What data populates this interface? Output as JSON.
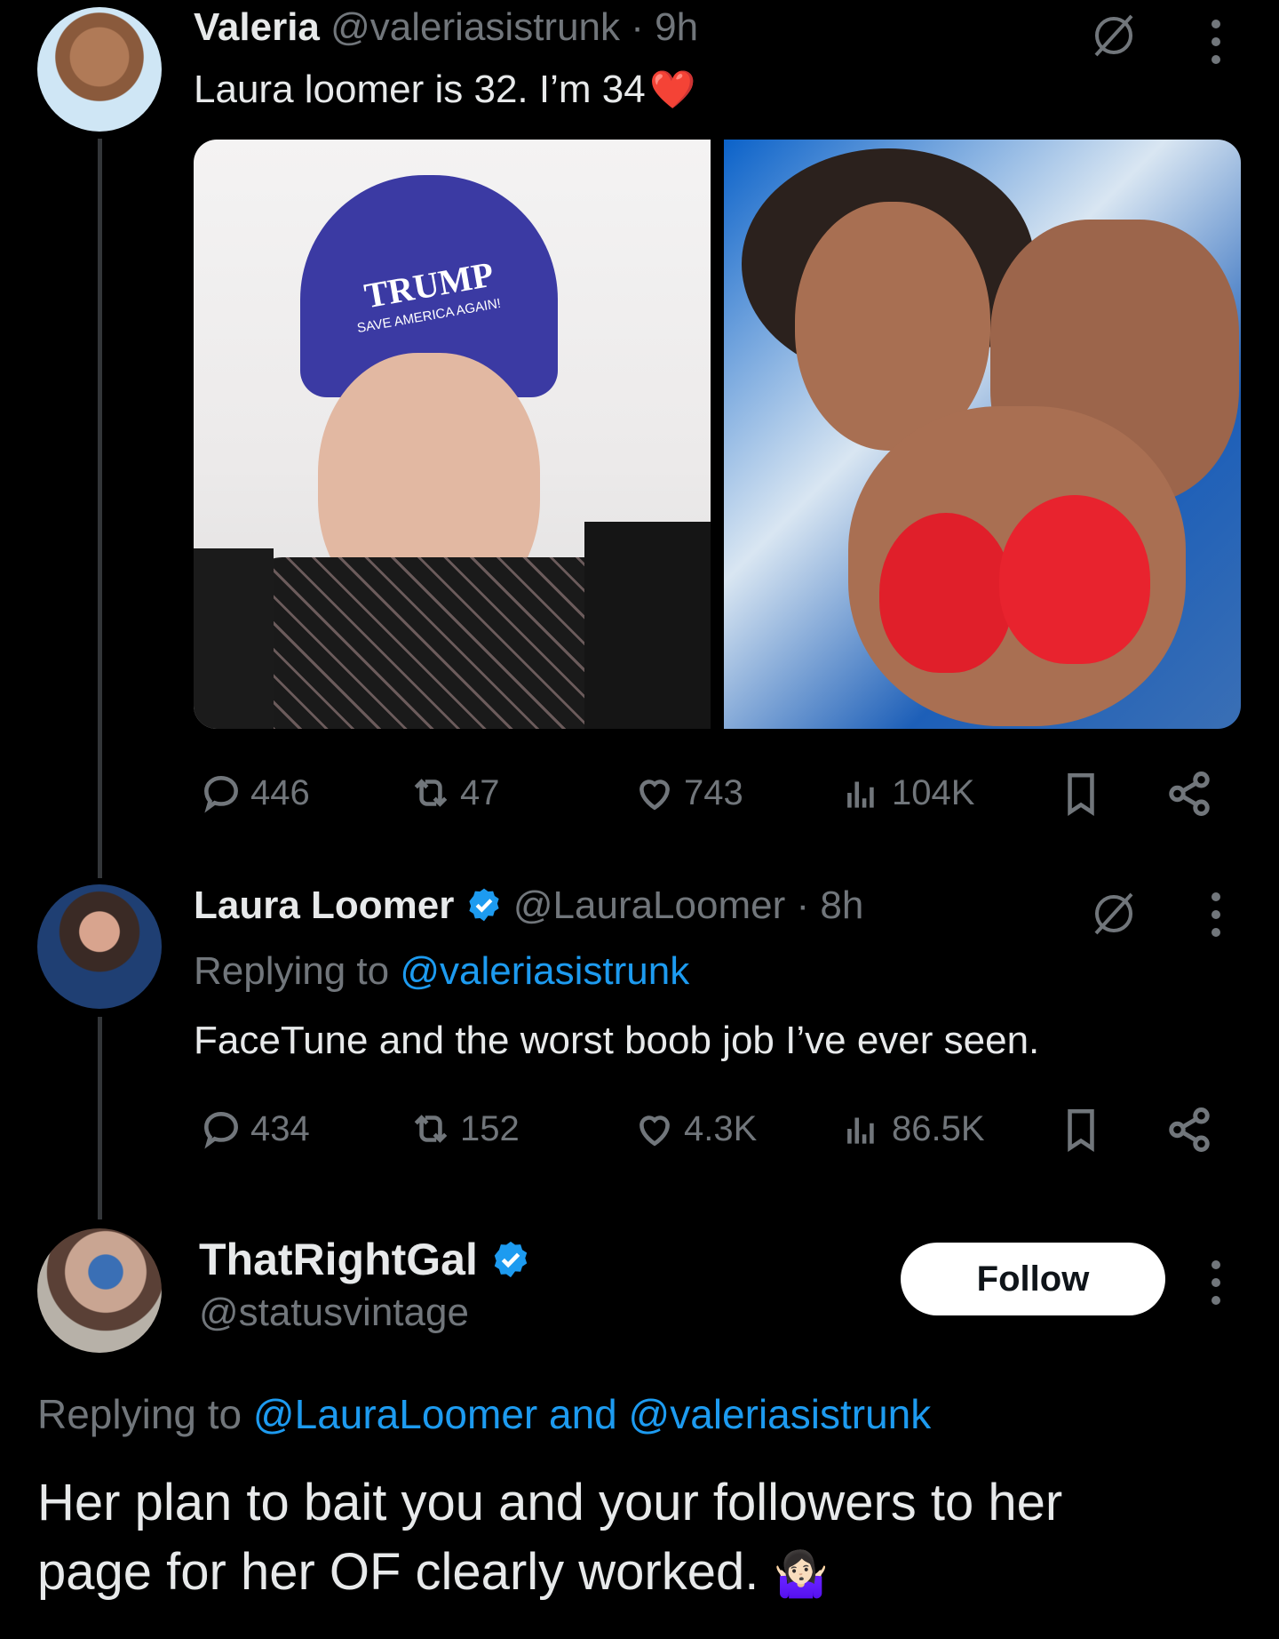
{
  "tweet1": {
    "name": "Valeria",
    "handle": "@valeriasistrunk",
    "time": "· 9h",
    "text": "Laura loomer is 32. I’m 34",
    "emoji": "❤️",
    "image_left_text": [
      "TRUMP",
      "SAVE AMERICA AGAIN!"
    ],
    "stats": {
      "replies": "446",
      "reposts": "47",
      "likes": "743",
      "views": "104K"
    }
  },
  "tweet2": {
    "name": "Laura Loomer",
    "handle": "@LauraLoomer",
    "time": "· 8h",
    "replying_prefix": "Replying to",
    "replying_to": "@valeriasistrunk",
    "text": "FaceTune and the worst boob job I’ve ever seen.",
    "stats": {
      "replies": "434",
      "reposts": "152",
      "likes": "4.3K",
      "views": "86.5K"
    }
  },
  "tweet3": {
    "name": "ThatRightGal",
    "handle": "@statusvintage",
    "follow_label": "Follow",
    "replying_prefix": "Replying to",
    "replying_to": "@LauraLoomer and @valeriasistrunk",
    "text_line1": "Her plan to bait you and your followers to her",
    "text_line2": "page for her OF clearly worked.",
    "emoji": "🤷🏻‍♀️"
  },
  "colors": {
    "accent": "#1d9bf0",
    "muted": "#71767b",
    "text": "#e7e9ea",
    "background": "#000000"
  },
  "icons": [
    "reply-icon",
    "repost-icon",
    "like-icon",
    "views-icon",
    "bookmark-icon",
    "share-icon",
    "grok-icon",
    "more-icon",
    "verified-icon"
  ]
}
